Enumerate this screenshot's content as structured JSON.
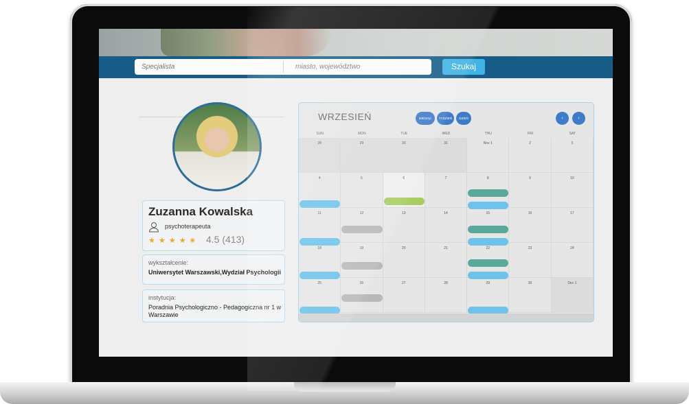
{
  "search": {
    "specialist_placeholder": "Specjalista",
    "location_placeholder": "miasto, województwo",
    "button_label": "Szukaj"
  },
  "profile": {
    "name": "Zuzanna Kowalska",
    "profession": "psychoterapeuta",
    "stars": "★ ★ ★ ★ ✬",
    "rating": "4.5 (413)",
    "rating_value": 4.5,
    "education_label": "wykształcenie:",
    "education_value": "Uniwersytet Warszawski,Wydział Psychologii",
    "institution_label": "instytucja:",
    "institution_value": "Poradnia Psychologiczno - Pedagogiczna nr 1 w Warszawie"
  },
  "calendar": {
    "month": "WRZESIEŃ",
    "views": [
      "MIESIĄC",
      "TYDZIEŃ",
      "DZIEŃ"
    ],
    "prev_symbol": "‹",
    "next_symbol": "›",
    "day_headers": [
      "SUN",
      "MON",
      "TUE",
      "WED",
      "THU",
      "FRI",
      "SAT"
    ],
    "weeks": [
      [
        "28",
        "29",
        "30",
        "31",
        "Nov 1",
        "2",
        "3"
      ],
      [
        "4",
        "5",
        "6",
        "7",
        "8",
        "9",
        "10"
      ],
      [
        "11",
        "12",
        "13",
        "14",
        "15",
        "16",
        "17"
      ],
      [
        "18",
        "19",
        "20",
        "21",
        "22",
        "23",
        "24"
      ],
      [
        "25",
        "26",
        "27",
        "28",
        "29",
        "30",
        "Dec 1"
      ]
    ],
    "event_colors": {
      "blue": "#6ec3ea",
      "teal": "#5aa89c",
      "green": "#a9cc63",
      "gray": "#b7b9bb"
    }
  },
  "colors": {
    "header_bar": "#175c86",
    "search_button": "#3fb3e3",
    "calendar_button": "#3e7bc8",
    "star": "#f0a51e"
  }
}
